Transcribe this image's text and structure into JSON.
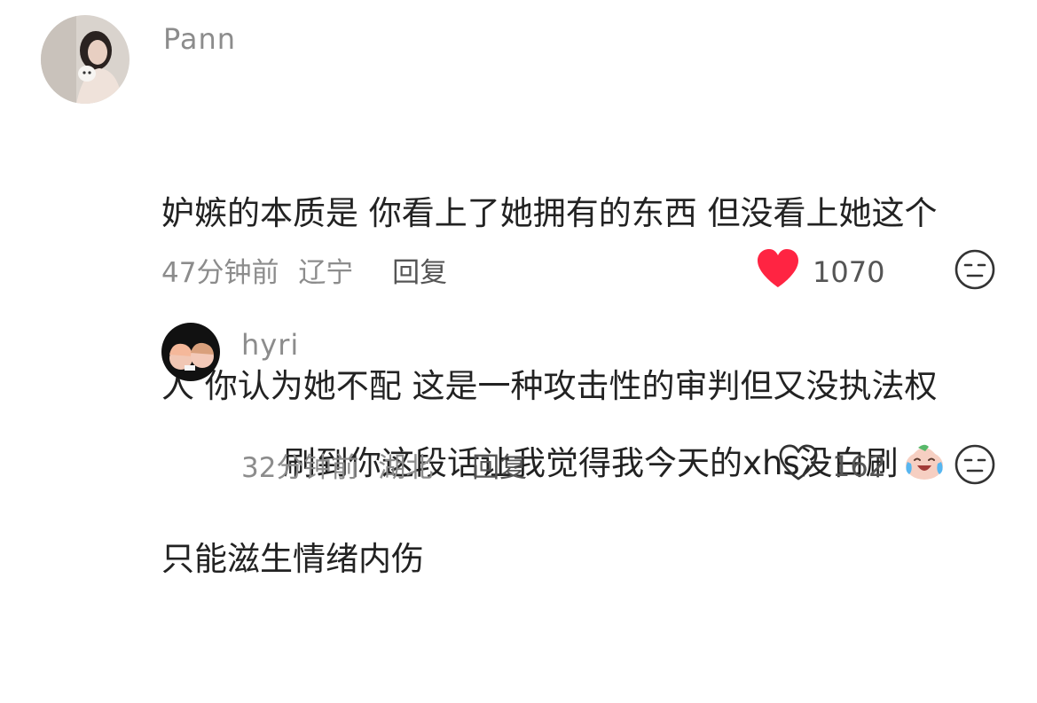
{
  "comments": [
    {
      "username": "Pann",
      "text_line1": "妒嫉的本质是 你看上了她拥有的东西 但没看上她这个",
      "text_line2": "人 你认为她不配 这是一种攻击性的审判但又没执法权",
      "text_line3": "只能滋生情绪内伤",
      "time": "47分钟前",
      "location": "辽宁",
      "reply_label": "回复",
      "likes": "1070",
      "liked": true,
      "like_icon": "heart-filled-icon",
      "dislike_icon": "neutral-face-icon"
    },
    {
      "username": "hyri",
      "text": "刷到你这段话让我觉得我今天的xhs没白刷",
      "emoji_icon": "crying-laughing-emoji",
      "time": "32分钟前",
      "location": "湖北",
      "reply_label": "回复",
      "likes": "162",
      "liked": false,
      "like_icon": "heart-outline-icon",
      "dislike_icon": "neutral-face-icon"
    }
  ],
  "colors": {
    "like_red": "#ff2442",
    "meta_gray": "#8c8c8c"
  }
}
